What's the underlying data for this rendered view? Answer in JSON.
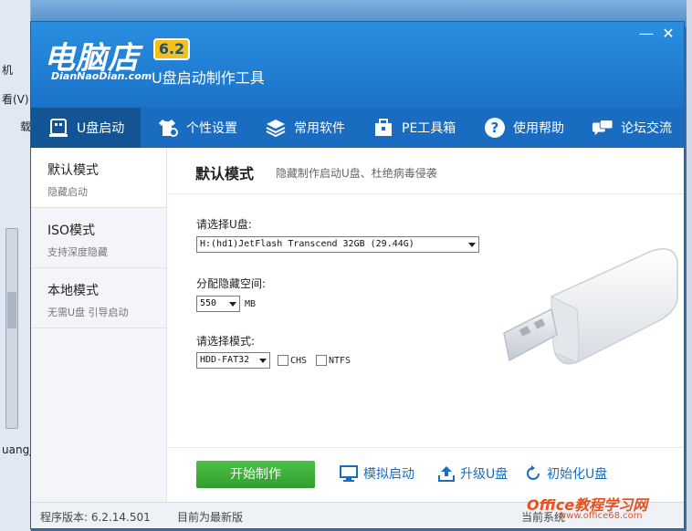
{
  "background": {
    "left_texts": [
      "机",
      "看(V)",
      "载",
      "uangj"
    ]
  },
  "window": {
    "logo": "电脑店",
    "logo_sub": "DianNaoDian.com",
    "version": "6.2",
    "subtitle": "U盘启动制作工具",
    "minimize_label": "—",
    "close_label": "✕"
  },
  "nav": {
    "items": [
      {
        "label": "U盘启动",
        "icon": "usb-drive-icon"
      },
      {
        "label": "个性设置",
        "icon": "shirt-gear-icon"
      },
      {
        "label": "常用软件",
        "icon": "layers-icon"
      },
      {
        "label": "PE工具箱",
        "icon": "toolbox-icon"
      },
      {
        "label": "使用帮助",
        "icon": "help-icon"
      },
      {
        "label": "论坛交流",
        "icon": "chat-icon"
      }
    ]
  },
  "sidebar": {
    "items": [
      {
        "title": "默认模式",
        "desc": "隐藏启动"
      },
      {
        "title": "ISO模式",
        "desc": "支持深度隐藏"
      },
      {
        "title": "本地模式",
        "desc": "无需U盘 引导启动"
      }
    ]
  },
  "content": {
    "title": "默认模式",
    "desc": "隐藏制作启动U盘、杜绝病毒侵袭",
    "disk_label": "请选择U盘:",
    "disk_value": "H:(hd1)JetFlash Transcend 32GB (29.44G)",
    "space_label": "分配隐藏空间:",
    "space_value": "550",
    "space_unit": "MB",
    "mode_label": "请选择模式:",
    "mode_value": "HDD-FAT32",
    "chs_label": "CHS",
    "ntfs_label": "NTFS"
  },
  "actions": {
    "start": "开始制作",
    "simulate": "模拟启动",
    "upgrade": "升级U盘",
    "init": "初始化U盘"
  },
  "status": {
    "version_text": "程序版本: 6.2.14.501",
    "latest_text": "目前为最新版",
    "system_text": "当前系统"
  },
  "watermark": {
    "text": "Office教程学习网",
    "sub": "www.office68.com"
  }
}
